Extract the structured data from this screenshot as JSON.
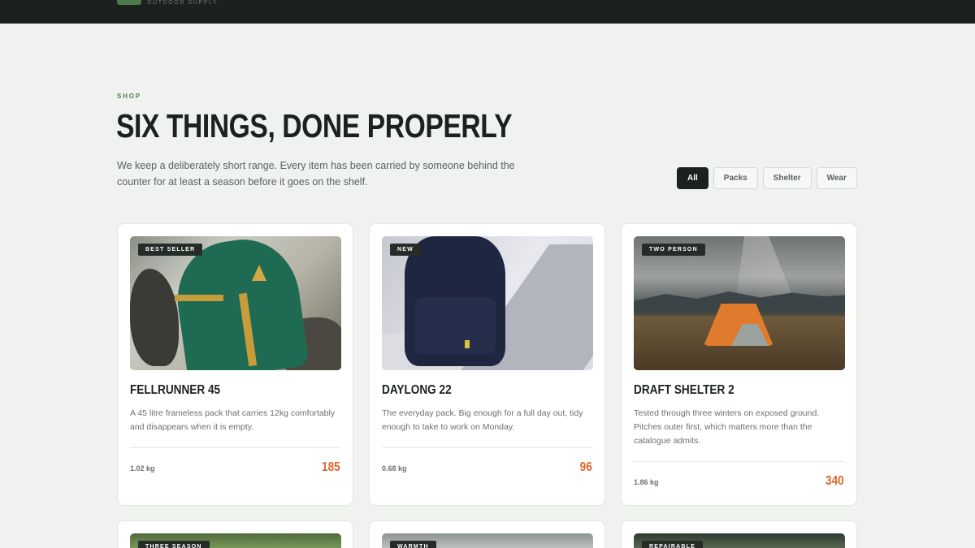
{
  "header": {
    "tagline": "OUTDOOR SUPPLY"
  },
  "shop": {
    "section_label": "SHOP",
    "title": "SIX THINGS, DONE PROPERLY",
    "intro": "We keep a deliberately short range. Every item has been carried by someone behind the counter for at least a season before it goes on the shelf."
  },
  "filters": [
    {
      "label": "All",
      "active": true
    },
    {
      "label": "Packs",
      "active": false
    },
    {
      "label": "Shelter",
      "active": false
    },
    {
      "label": "Wear",
      "active": false
    }
  ],
  "products": [
    {
      "badge": "BEST SELLER",
      "name": "FELLRUNNER 45",
      "description": "A 45 litre frameless pack that carries 12kg comfortably and disappears when it is empty.",
      "weight": "1.02 kg",
      "price": "185"
    },
    {
      "badge": "NEW",
      "name": "DAYLONG 22",
      "description": "The everyday pack. Big enough for a full day out, tidy enough to take to work on Monday.",
      "weight": "0.68 kg",
      "price": "96"
    },
    {
      "badge": "TWO PERSON",
      "name": "DRAFT SHELTER 2",
      "description": "Tested through three winters on exposed ground. Pitches outer first, which matters more than the catalogue admits.",
      "weight": "1.86 kg",
      "price": "340"
    },
    {
      "badge": "THREE SEASON"
    },
    {
      "badge": "WARMTH"
    },
    {
      "badge": "REPAIRABLE"
    }
  ],
  "colors": {
    "accent_price": "#e0662a",
    "brand_green": "#4c7a4f",
    "dark": "#1b211d"
  }
}
